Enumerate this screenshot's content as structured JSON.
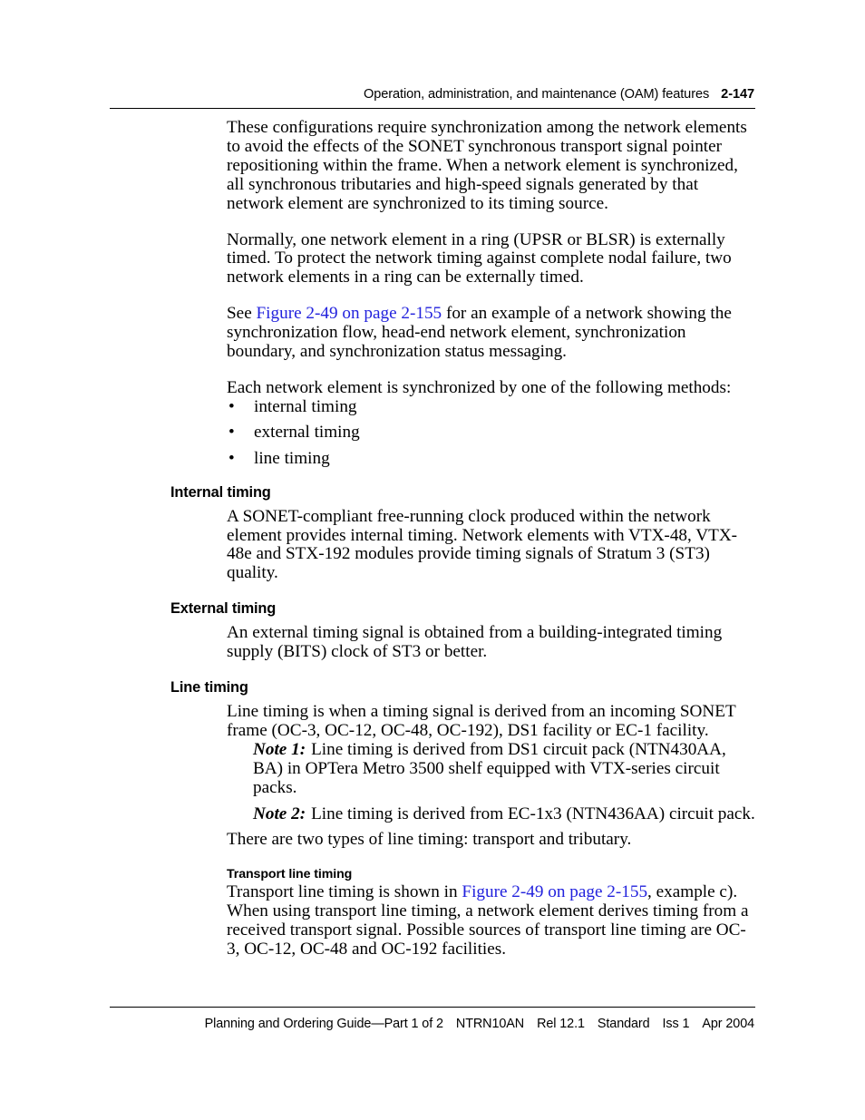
{
  "header": {
    "title": "Operation, administration, and maintenance (OAM) features",
    "page_number": "2-147"
  },
  "body": {
    "para_1": "These configurations require synchronization among the network elements to avoid the effects of the SONET synchronous transport signal pointer repositioning within the frame. When a network element is synchronized, all synchronous tributaries and high-speed signals generated by that network element are synchronized to its timing source.",
    "para_2": "Normally, one network element in a ring (UPSR or BLSR) is externally timed. To protect the network timing against complete nodal failure, two network elements in a ring can be externally timed.",
    "para_3_before": "See ",
    "para_3_link": "Figure 2-49 on page 2-155",
    "para_3_after": " for an example of a network showing the synchronization flow, head-end network element, synchronization boundary, and synchronization status messaging.",
    "para_4": "Each network element is synchronized by one of the following methods:",
    "bullet_marker": "•",
    "bullets": [
      "internal timing",
      "external timing",
      "line timing"
    ],
    "there_are_two_types": "There are two types of line timing: transport and tributary."
  },
  "sections": {
    "internal_timing": {
      "heading": "Internal timing",
      "para": "A SONET-compliant free-running clock produced within the network element provides internal timing. Network elements with VTX-48, VTX-48e and STX-192 modules provide timing signals of Stratum 3 (ST3) quality."
    },
    "external_timing": {
      "heading": "External timing",
      "para": "An external timing signal is obtained from a building-integrated timing supply (BITS) clock of ST3 or better."
    },
    "line_timing": {
      "heading": "Line timing",
      "para": "Line timing is when a timing signal is derived from an incoming SONET frame (OC-3, OC-12, OC-48, OC-192), DS1 facility or EC-1 facility.",
      "note_1_label": "Note 1:",
      "note_1_text": "Line timing is derived from DS1 circuit pack (NTN430AA, BA) in OPTera Metro 3500 shelf equipped with VTX-series circuit packs.",
      "note_2_label": "Note 2:",
      "note_2_text": "Line timing is derived from EC-1x3 (NTN436AA) circuit pack."
    },
    "transport_line_timing": {
      "heading": "Transport line timing",
      "para_before": "Transport line timing is shown in ",
      "para_link": "Figure 2-49 on page 2-155",
      "para_after": ", example c). When using transport line timing, a network element derives timing from a received transport signal. Possible sources of transport line timing are OC-3, OC-12, OC-48 and OC-192 facilities."
    }
  },
  "footer": {
    "guide": "Planning and Ordering Guide—Part 1 of 2",
    "doc_number": "NTRN10AN",
    "release": "Rel 12.1",
    "status": "Standard",
    "issue": "Iss 1",
    "date": "Apr 2004"
  },
  "colors": {
    "link": "#2222dd",
    "text": "#000000",
    "background": "#ffffff"
  }
}
